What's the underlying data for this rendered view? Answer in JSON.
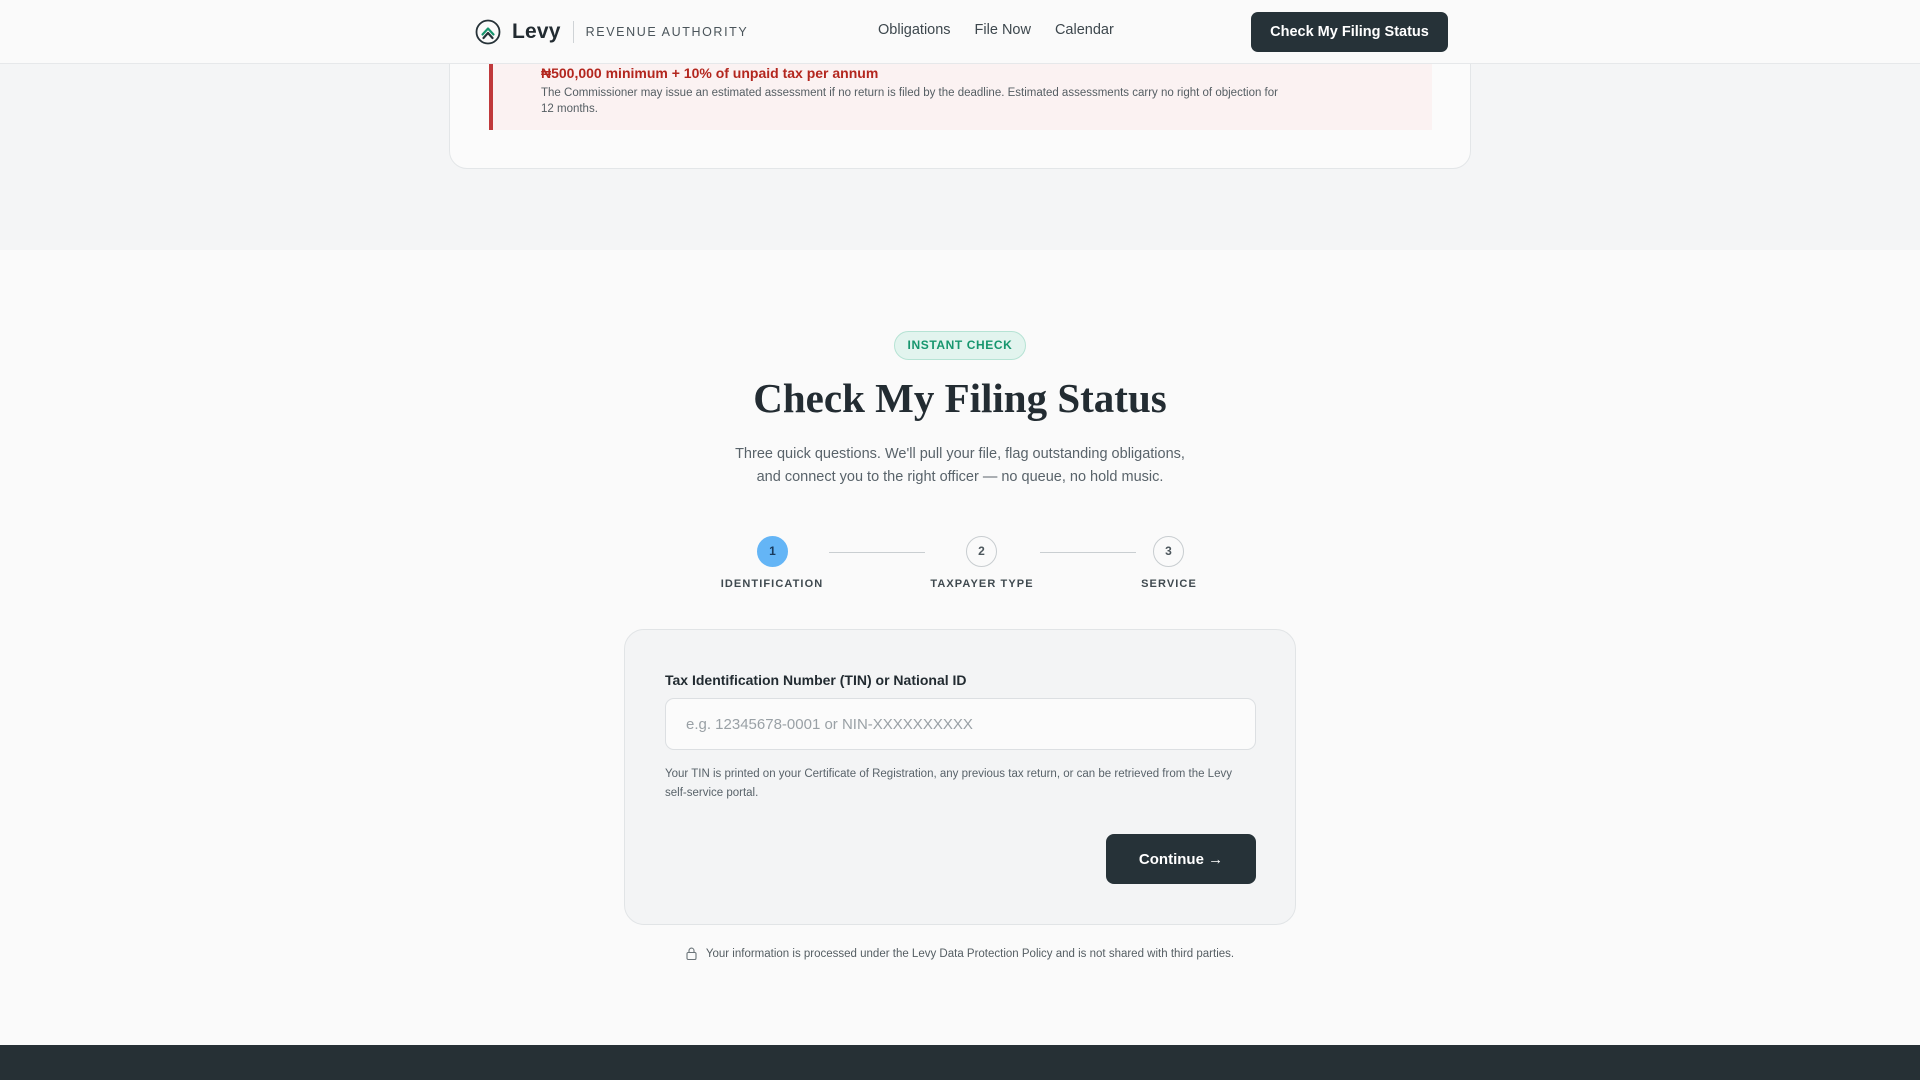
{
  "nav": {
    "brand_name": "Levy",
    "brand_sub": "REVENUE AUTHORITY",
    "links": [
      "Obligations",
      "File Now",
      "Calendar"
    ],
    "cta_label": "Check My Filing Status"
  },
  "penalty": {
    "amount": "₦500,000 minimum + 10% of unpaid tax per annum",
    "text": "The Commissioner may issue an estimated assessment if no return is filed by the deadline. Estimated assessments carry no right of objection for 12 months."
  },
  "main": {
    "badge": "INSTANT CHECK",
    "title": "Check My Filing Status",
    "subtitle_line1": "Three quick questions. We'll pull your file, flag outstanding obligations,",
    "subtitle_line2": "and connect you to the right officer — no queue, no hold music."
  },
  "stepper": {
    "current_step": 1,
    "steps": [
      {
        "number": "1",
        "label": "IDENTIFICATION"
      },
      {
        "number": "2",
        "label": "TAXPAYER TYPE"
      },
      {
        "number": "3",
        "label": "SERVICE"
      }
    ]
  },
  "form": {
    "label": "Tax Identification Number (TIN) or National ID",
    "placeholder": "e.g. 12345678-0001 or NIN-XXXXXXXXXX",
    "value": "",
    "help": "Your TIN is printed on your Certificate of Registration, any previous tax return, or can be retrieved from the Levy self-service portal.",
    "continue_label": "Continue →"
  },
  "privacy_text": "Your information is processed under the Levy Data Protection Policy and is not shared with third parties.",
  "colors": {
    "primary_dark": "#263238",
    "accent_green": "#17966e",
    "step_active": "#64b5f6",
    "alert_red": "#c0393b"
  },
  "icons": {
    "brand": "levy-logo-icon",
    "lock": "lock-icon"
  }
}
